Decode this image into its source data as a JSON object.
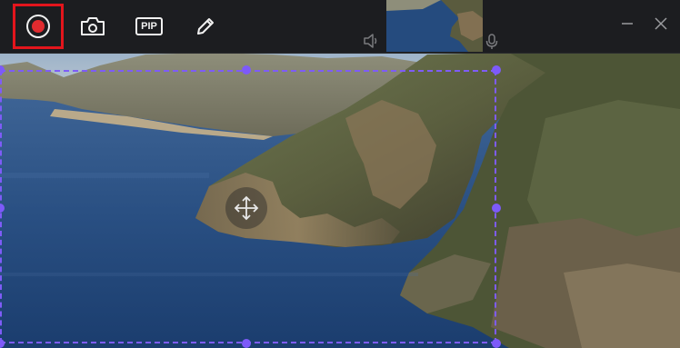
{
  "toolbar": {
    "record_button_state": "active",
    "screenshot_button": "camera-icon",
    "pip_label": "PIP",
    "draw_button": "pencil-icon",
    "speaker_icon": "speaker-icon",
    "microphone_icon": "microphone-icon"
  },
  "window_controls": {
    "minimize": "minimize-icon",
    "close": "close-icon"
  },
  "colors": {
    "active_outline": "#e3151c",
    "record_dot": "#e02b2f",
    "selection": "#7e5cf7",
    "toolbar_bg": "#1c1d20"
  }
}
